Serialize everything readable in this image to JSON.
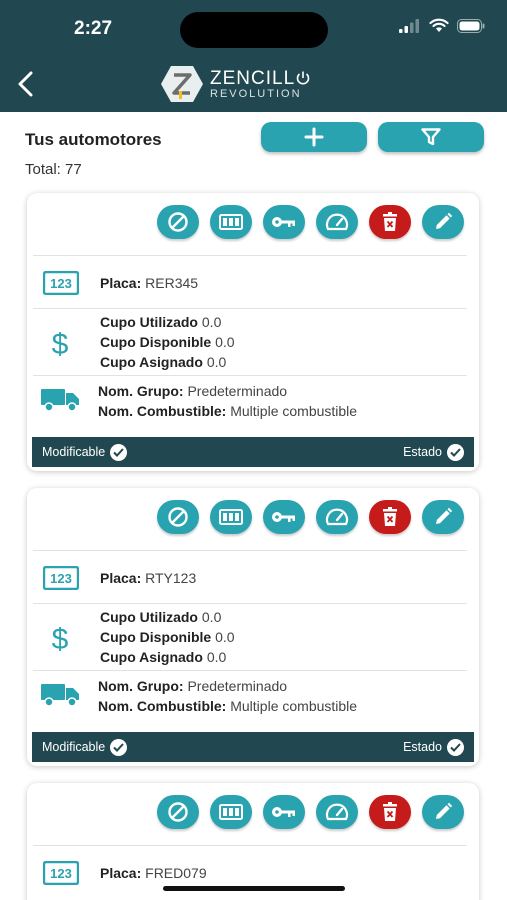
{
  "status_bar": {
    "time": "2:27"
  },
  "header": {
    "logo_main": "ZENCILL",
    "logo_sub": "REVOLUTION"
  },
  "page": {
    "title": "Tus automotores",
    "total": "Total: 77"
  },
  "labels": {
    "placa": "Placa:",
    "cupo_utilizado": "Cupo Utilizado",
    "cupo_disponible": "Cupo Disponible",
    "cupo_asignado": "Cupo Asignado",
    "nom_grupo": "Nom. Grupo:",
    "nom_combustible": "Nom. Combustible:",
    "modificable": "Modificable",
    "estado": "Estado"
  },
  "vehicles": [
    {
      "placa": "RER345",
      "cupo_utilizado": "0.0",
      "cupo_disponible": "0.0",
      "cupo_asignado": "0.0",
      "grupo": "Predeterminado",
      "combustible": "Multiple combustible"
    },
    {
      "placa": "RTY123",
      "cupo_utilizado": "0.0",
      "cupo_disponible": "0.0",
      "cupo_asignado": "0.0",
      "grupo": "Predeterminado",
      "combustible": "Multiple combustible"
    },
    {
      "placa": "FRED079"
    }
  ],
  "colors": {
    "primary": "#29a3af",
    "dark": "#214850",
    "danger": "#c51b1b"
  }
}
